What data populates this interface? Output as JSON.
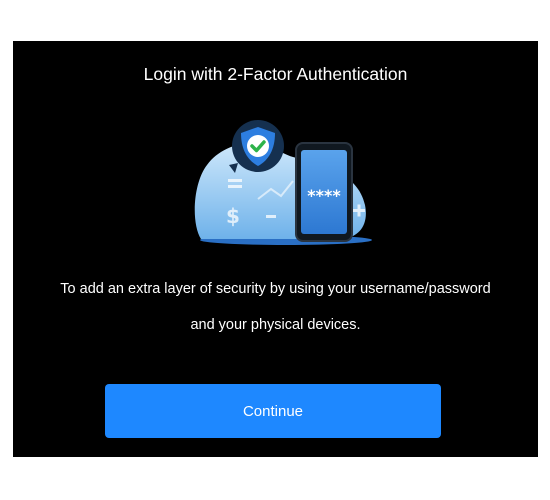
{
  "dialog": {
    "title": "Login with 2-Factor Authentication",
    "description_lines": [
      "To add an extra layer of security by using your username/password",
      "and your physical devices."
    ],
    "continue_label": "Continue",
    "illustration": {
      "phone_code": "****",
      "icons": [
        "shield-check-icon",
        "smartphone-icon",
        "dollar-icon",
        "equals-icon",
        "minus-icon",
        "plus-icon",
        "trend-line-icon"
      ]
    }
  },
  "colors": {
    "dialog_background": "#000000",
    "button": "#1e88ff",
    "shield": "#1f6fd1",
    "check": "#2db34a",
    "blob": "#a9d4f5"
  }
}
